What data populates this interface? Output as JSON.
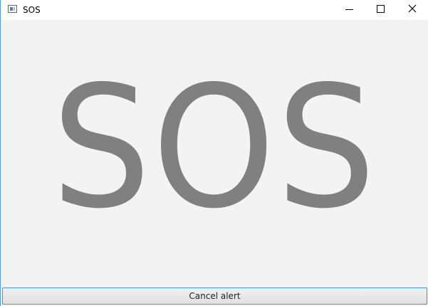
{
  "window": {
    "title": "SOS",
    "icon": "app-window-icon",
    "controls": {
      "minimize_icon": "minimize-icon",
      "maximize_icon": "maximize-icon",
      "close_icon": "close-icon"
    }
  },
  "main": {
    "alert_text": "SOS",
    "alert_color": "#808080"
  },
  "footer": {
    "cancel_label": "Cancel alert",
    "accent": "#3c9ad8"
  }
}
